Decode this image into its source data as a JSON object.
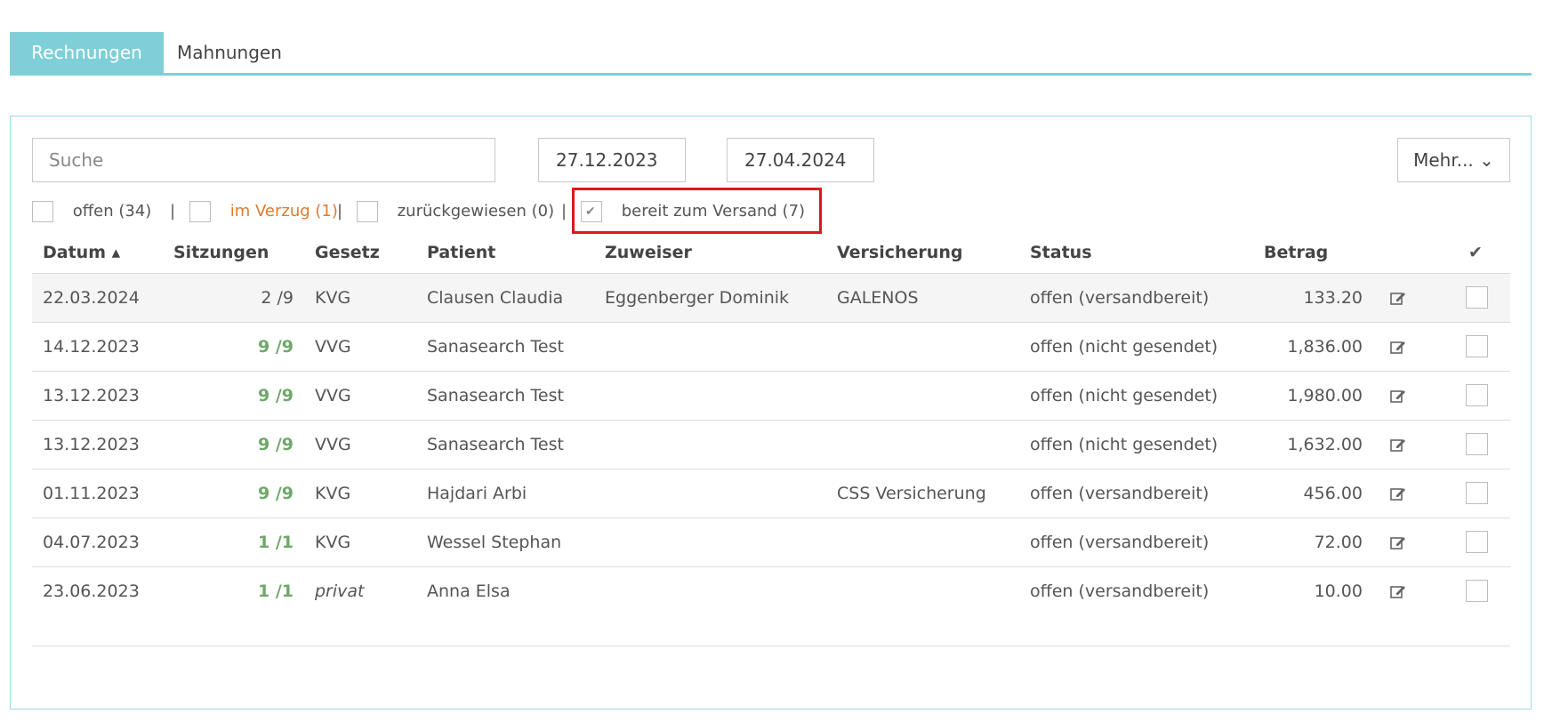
{
  "tabs": [
    {
      "label": "Rechnungen",
      "active": true
    },
    {
      "label": "Mahnungen",
      "active": false
    }
  ],
  "search": {
    "placeholder": "Suche"
  },
  "dates": {
    "from": "27.12.2023",
    "to": "27.04.2024"
  },
  "more_label": "Mehr... ⌄",
  "filters": [
    {
      "label": "offen (34)",
      "checked": false
    },
    {
      "label": "im Verzug (1)",
      "checked": false,
      "color": "#e07b2a"
    },
    {
      "label": "zurückgewiesen (0)",
      "checked": false
    },
    {
      "label": "bereit zum Versand (7)",
      "checked": true
    }
  ],
  "filter_separator": "|",
  "table": {
    "headers": {
      "datum": "Datum ▴",
      "sitzungen": "Sitzungen",
      "gesetz": "Gesetz",
      "patient": "Patient",
      "zuweiser": "Zuweiser",
      "versicherung": "Versicherung",
      "status": "Status",
      "betrag": "Betrag",
      "select": "✔"
    },
    "rows": [
      {
        "datum": "22.03.2024",
        "sitzungen": "2 /9",
        "gesetz": "KVG",
        "patient": "Clausen Claudia",
        "zuweiser": "Eggenberger Dominik",
        "versicherung": "GALENOS",
        "status": "offen (versandbereit)",
        "betrag": "133.20"
      },
      {
        "datum": "14.12.2023",
        "sitzungen": "9 /9",
        "gesetz": "VVG",
        "patient": "Sanasearch Test",
        "zuweiser": "",
        "versicherung": "",
        "status": "offen (nicht gesendet)",
        "betrag": "1,836.00"
      },
      {
        "datum": "13.12.2023",
        "sitzungen": "9 /9",
        "gesetz": "VVG",
        "patient": "Sanasearch Test",
        "zuweiser": "",
        "versicherung": "",
        "status": "offen (nicht gesendet)",
        "betrag": "1,980.00"
      },
      {
        "datum": "13.12.2023",
        "sitzungen": "9 /9",
        "gesetz": "VVG",
        "patient": "Sanasearch Test",
        "zuweiser": "",
        "versicherung": "",
        "status": "offen (nicht gesendet)",
        "betrag": "1,632.00"
      },
      {
        "datum": "01.11.2023",
        "sitzungen": "9 /9",
        "gesetz": "KVG",
        "patient": "Hajdari Arbi",
        "zuweiser": "",
        "versicherung": "CSS Versicherung",
        "status": "offen (versandbereit)",
        "betrag": "456.00"
      },
      {
        "datum": "04.07.2023",
        "sitzungen": "1 /1",
        "gesetz": "KVG",
        "patient": "Wessel Stephan",
        "zuweiser": "",
        "versicherung": "",
        "status": "offen (versandbereit)",
        "betrag": "72.00"
      },
      {
        "datum": "23.06.2023",
        "sitzungen": "1 /1",
        "gesetz": "privat",
        "patient": "Anna Elsa",
        "zuweiser": "",
        "versicherung": "",
        "status": "offen (versandbereit)",
        "betrag": "10.00"
      }
    ]
  },
  "icons": {
    "edit": "edit-icon",
    "check": "check-icon",
    "sort": "sort-asc-icon"
  },
  "colors": {
    "accent": "#7fcfd8",
    "highlight": "#e0161e",
    "green": "#6fa86a",
    "orange": "#e07b2a"
  }
}
